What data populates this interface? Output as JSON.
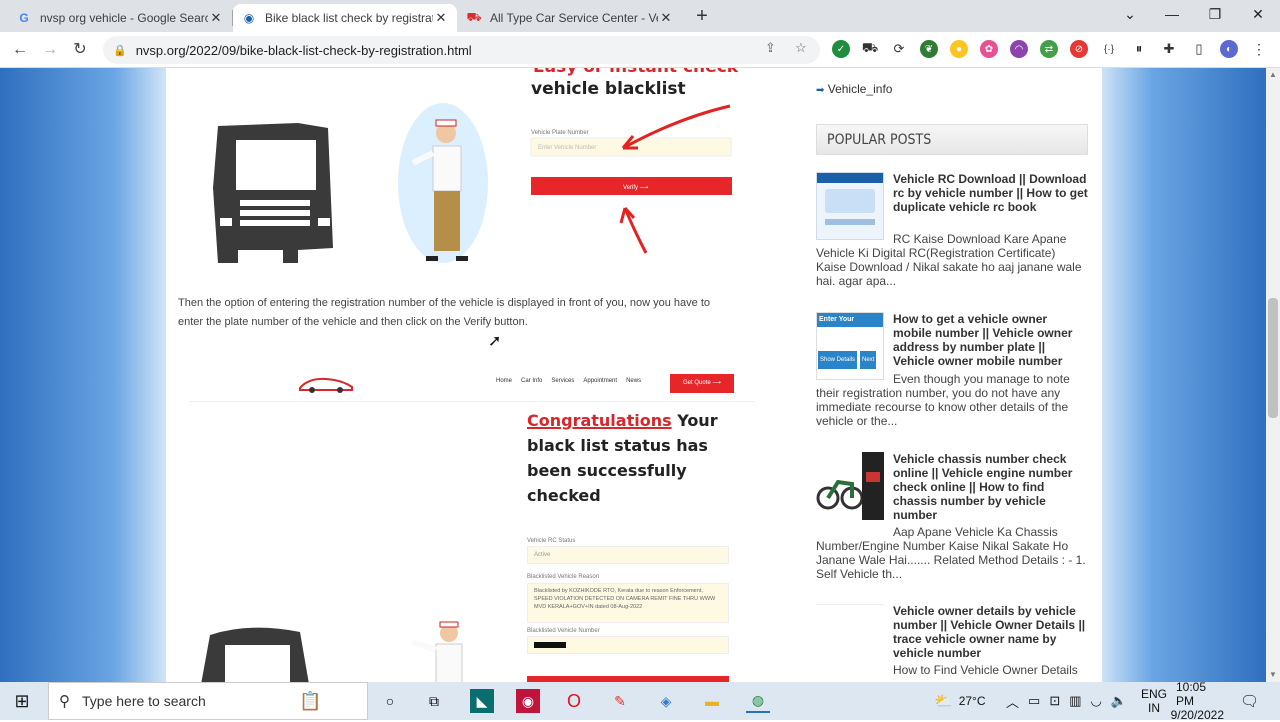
{
  "browser": {
    "tabs": [
      {
        "label": "nvsp org vehicle - Google Search",
        "icon": "google-g-icon",
        "close": "✕"
      },
      {
        "label": "Bike black list check by registrati",
        "icon": "globe-icon",
        "close": "✕"
      },
      {
        "label": "All Type Car Service Center - Vehi",
        "icon": "car-favicon-icon",
        "close": "✕"
      }
    ],
    "new_tab": "+",
    "url": "nvsp.org/2022/09/bike-black-list-check-by-registration.html",
    "window_controls": [
      "⌄",
      "—",
      "❐",
      "✕"
    ]
  },
  "article": {
    "top_heading_partial": "Easy or instant check",
    "top_heading_line2": "vehicle blacklist",
    "form1": {
      "label": "Vehicle Plate Number",
      "placeholder": "Enter Vehicle Number",
      "button": "Verify ⟶"
    },
    "paragraph": "Then the option of entering the registration number of the vehicle is displayed in front of you, now you have to enter the plate number of the vehicle and then click on the Verify button.",
    "site_nav": {
      "items": [
        "Home",
        "Car Info",
        "Services",
        "Appointment",
        "News"
      ],
      "cta": "Get Quote ⟶"
    },
    "result": {
      "heading_red": "Congratulations",
      "heading_rest": " Your",
      "heading_line2": "black list status has",
      "heading_line3": "been successfully",
      "heading_line4": "checked",
      "status_label": "Vehicle RC Status",
      "status_value": "Active",
      "reason_label": "Blacklisted Vehicle Reason",
      "reason_value": "Blacklisted by KOZHIKODE RTO, Kerala due to reason Enforcement, SPEED VIOLATION DETECTED ON CAMERA REMIT FINE THRU WWW MVD KERALA+GOV+IN dated 08-Aug-2022",
      "number_label": "Blacklisted Vehicle Number"
    }
  },
  "sidebar": {
    "link": "Vehicle_info",
    "popular_heading": "POPULAR POSTS",
    "posts": [
      {
        "title": "Vehicle RC Download || Download rc by vehicle number || How to get duplicate vehicle rc book",
        "excerpt": "RC Kaise Download Kare  Apane Vehicle Ki Digital RC(Registration Certificate) Kaise Download / Nikal sakate ho aaj janane wale hai. agar apa..."
      },
      {
        "title": "How to get a vehicle owner mobile number || Vehicle owner address by number plate || Vehicle owner mobile number",
        "excerpt": "Even though you manage to note their registration number, you do not have any immediate recourse to know other details of the vehicle or the..."
      },
      {
        "title": "Vehicle chassis number check online || Vehicle engine number check online || How to find chassis number by vehicle number",
        "excerpt": "Aap Apane Vehicle Ka Chassis Number/Engine Number Kaise Nikal Sakate Ho Janane Wale Hai....... Related Method Details : - 1. Self Vehicle th..."
      },
      {
        "title": "Vehicle owner details by vehicle number || Vehicle Owner Details || trace vehicle owner name by vehicle number",
        "excerpt": "How to Find Vehicle Owner Details"
      }
    ],
    "thumb1_text": "Enter Your Application",
    "thumb1_btn1": "Show Details",
    "thumb1_btn2": "Next"
  },
  "taskbar": {
    "search_placeholder": "Type here to search",
    "weather": "27°C",
    "lang_top": "ENG",
    "lang_bottom": "IN",
    "time": "10:05 PM",
    "date": "9/20/2022"
  },
  "colors": {
    "accent_red": "#e7262a",
    "tab_bg": "#dee1e6",
    "page_bg_blue": "#3a7cc8"
  }
}
